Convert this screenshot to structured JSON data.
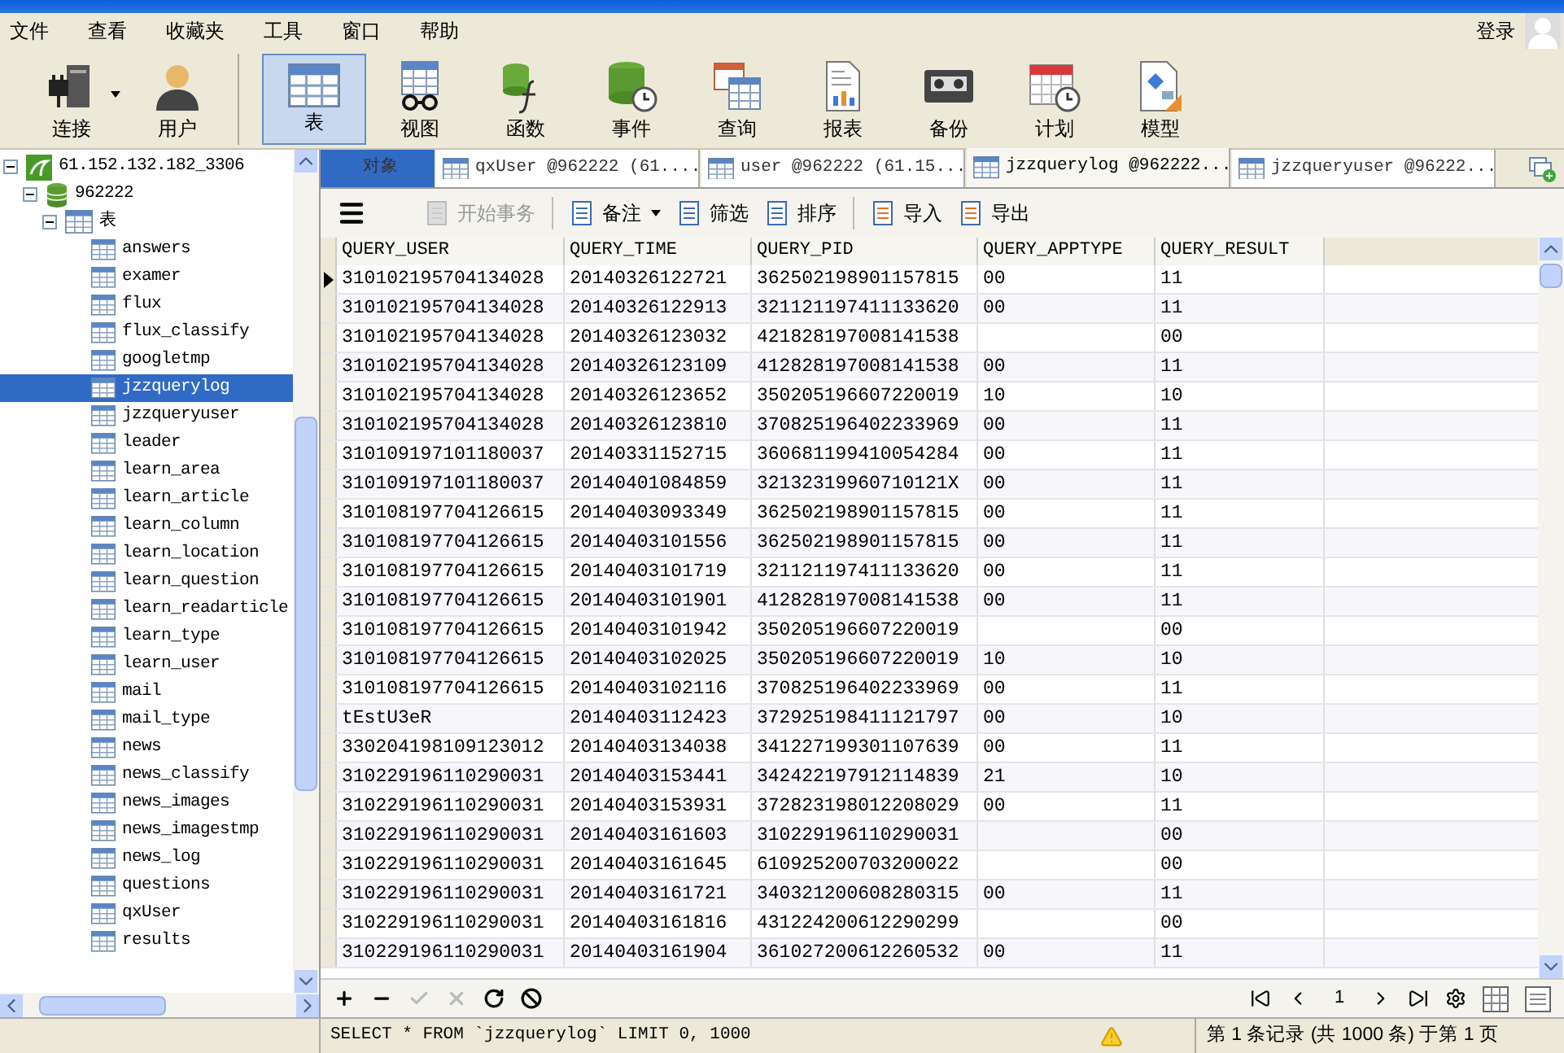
{
  "menu": [
    "文件",
    "查看",
    "收藏夹",
    "工具",
    "窗口",
    "帮助"
  ],
  "login": "登录",
  "toolbar": [
    {
      "label": "连接",
      "selected": false,
      "dropdown": true
    },
    {
      "label": "用户",
      "selected": false,
      "dropdown": false
    },
    {
      "label": "表",
      "selected": true,
      "dropdown": false
    },
    {
      "label": "视图",
      "selected": false,
      "dropdown": false
    },
    {
      "label": "函数",
      "selected": false,
      "dropdown": false
    },
    {
      "label": "事件",
      "selected": false,
      "dropdown": false
    },
    {
      "label": "查询",
      "selected": false,
      "dropdown": false
    },
    {
      "label": "报表",
      "selected": false,
      "dropdown": false
    },
    {
      "label": "备份",
      "selected": false,
      "dropdown": false
    },
    {
      "label": "计划",
      "selected": false,
      "dropdown": false
    },
    {
      "label": "模型",
      "selected": false,
      "dropdown": false
    }
  ],
  "tree": [
    {
      "label": "61.152.132.182_3306",
      "kind": "server",
      "expanded": true,
      "selected": false,
      "children": [
        {
          "label": "962222",
          "kind": "database",
          "expanded": true,
          "selected": false,
          "children": [
            {
              "label": "表",
              "kind": "folder",
              "expanded": true,
              "selected": false,
              "children": [
                {
                  "label": "answers",
                  "kind": "table",
                  "selected": false
                },
                {
                  "label": "examer",
                  "kind": "table",
                  "selected": false
                },
                {
                  "label": "flux",
                  "kind": "table",
                  "selected": false
                },
                {
                  "label": "flux_classify",
                  "kind": "table",
                  "selected": false
                },
                {
                  "label": "googletmp",
                  "kind": "table",
                  "selected": false
                },
                {
                  "label": "jzzquerylog",
                  "kind": "table",
                  "selected": true
                },
                {
                  "label": "jzzqueryuser",
                  "kind": "table",
                  "selected": false
                },
                {
                  "label": "leader",
                  "kind": "table",
                  "selected": false
                },
                {
                  "label": "learn_area",
                  "kind": "table",
                  "selected": false
                },
                {
                  "label": "learn_article",
                  "kind": "table",
                  "selected": false
                },
                {
                  "label": "learn_column",
                  "kind": "table",
                  "selected": false
                },
                {
                  "label": "learn_location",
                  "kind": "table",
                  "selected": false
                },
                {
                  "label": "learn_question",
                  "kind": "table",
                  "selected": false
                },
                {
                  "label": "learn_readarticle",
                  "kind": "table",
                  "selected": false
                },
                {
                  "label": "learn_type",
                  "kind": "table",
                  "selected": false
                },
                {
                  "label": "learn_user",
                  "kind": "table",
                  "selected": false
                },
                {
                  "label": "mail",
                  "kind": "table",
                  "selected": false
                },
                {
                  "label": "mail_type",
                  "kind": "table",
                  "selected": false
                },
                {
                  "label": "news",
                  "kind": "table",
                  "selected": false
                },
                {
                  "label": "news_classify",
                  "kind": "table",
                  "selected": false
                },
                {
                  "label": "news_images",
                  "kind": "table",
                  "selected": false
                },
                {
                  "label": "news_imagestmp",
                  "kind": "table",
                  "selected": false
                },
                {
                  "label": "news_log",
                  "kind": "table",
                  "selected": false
                },
                {
                  "label": "questions",
                  "kind": "table",
                  "selected": false
                },
                {
                  "label": "qxUser",
                  "kind": "table",
                  "selected": false
                },
                {
                  "label": "results",
                  "kind": "table",
                  "selected": false
                }
              ]
            }
          ]
        }
      ]
    }
  ],
  "tabs": [
    {
      "label": "对象",
      "kind": "objects",
      "selected": false
    },
    {
      "label": "qxUser @962222 (61....",
      "kind": "table",
      "selected": false
    },
    {
      "label": "user @962222 (61.15...",
      "kind": "table",
      "selected": false
    },
    {
      "label": "jzzquerylog @962222...",
      "kind": "table",
      "selected": true
    },
    {
      "label": "jzzqueryuser @96222...",
      "kind": "table",
      "selected": false
    }
  ],
  "actions": [
    {
      "label": "开始事务",
      "disabled": true,
      "dropdown": false
    },
    {
      "label": "备注",
      "disabled": false,
      "dropdown": true
    },
    {
      "label": "筛选",
      "disabled": false,
      "dropdown": false
    },
    {
      "label": "排序",
      "disabled": false,
      "dropdown": false
    },
    {
      "label": "导入",
      "disabled": false,
      "dropdown": false
    },
    {
      "label": "导出",
      "disabled": false,
      "dropdown": false
    }
  ],
  "table": {
    "columns": [
      "QUERY_USER",
      "QUERY_TIME",
      "QUERY_PID",
      "QUERY_APPTYPE",
      "QUERY_RESULT"
    ],
    "rows": [
      {
        "current": true,
        "cells": [
          "310102195704134028",
          "20140326122721",
          "362502198901157815",
          "00",
          "11"
        ]
      },
      {
        "current": false,
        "cells": [
          "310102195704134028",
          "20140326122913",
          "321121197411133620",
          "00",
          "11"
        ]
      },
      {
        "current": false,
        "cells": [
          "310102195704134028",
          "20140326123032",
          "421828197008141538",
          "",
          "00"
        ]
      },
      {
        "current": false,
        "cells": [
          "310102195704134028",
          "20140326123109",
          "412828197008141538",
          "00",
          "11"
        ]
      },
      {
        "current": false,
        "cells": [
          "310102195704134028",
          "20140326123652",
          "350205196607220019",
          "10",
          "10"
        ]
      },
      {
        "current": false,
        "cells": [
          "310102195704134028",
          "20140326123810",
          "370825196402233969",
          "00",
          "11"
        ]
      },
      {
        "current": false,
        "cells": [
          "310109197101180037",
          "20140331152715",
          "360681199410054284",
          "00",
          "11"
        ]
      },
      {
        "current": false,
        "cells": [
          "310109197101180037",
          "20140401084859",
          "32132319960710121X",
          "00",
          "11"
        ]
      },
      {
        "current": false,
        "cells": [
          "310108197704126615",
          "20140403093349",
          "362502198901157815",
          "00",
          "11"
        ]
      },
      {
        "current": false,
        "cells": [
          "310108197704126615",
          "20140403101556",
          "362502198901157815",
          "00",
          "11"
        ]
      },
      {
        "current": false,
        "cells": [
          "310108197704126615",
          "20140403101719",
          "321121197411133620",
          "00",
          "11"
        ]
      },
      {
        "current": false,
        "cells": [
          "310108197704126615",
          "20140403101901",
          "412828197008141538",
          "00",
          "11"
        ]
      },
      {
        "current": false,
        "cells": [
          "310108197704126615",
          "20140403101942",
          "350205196607220019",
          "",
          "00"
        ]
      },
      {
        "current": false,
        "cells": [
          "310108197704126615",
          "20140403102025",
          "350205196607220019",
          "10",
          "10"
        ]
      },
      {
        "current": false,
        "cells": [
          "310108197704126615",
          "20140403102116",
          "370825196402233969",
          "00",
          "11"
        ]
      },
      {
        "current": false,
        "cells": [
          "tEstU3eR",
          "20140403112423",
          "372925198411121797",
          "00",
          "10"
        ]
      },
      {
        "current": false,
        "cells": [
          "330204198109123012",
          "20140403134038",
          "341227199301107639",
          "00",
          "11"
        ]
      },
      {
        "current": false,
        "cells": [
          "310229196110290031",
          "20140403153441",
          "342422197912114839",
          "21",
          "10"
        ]
      },
      {
        "current": false,
        "cells": [
          "310229196110290031",
          "20140403153931",
          "372823198012208029",
          "00",
          "11"
        ]
      },
      {
        "current": false,
        "cells": [
          "310229196110290031",
          "20140403161603",
          "310229196110290031",
          "",
          "00"
        ]
      },
      {
        "current": false,
        "cells": [
          "310229196110290031",
          "20140403161645",
          "610925200703200022",
          "",
          "00"
        ]
      },
      {
        "current": false,
        "cells": [
          "310229196110290031",
          "20140403161721",
          "340321200608280315",
          "00",
          "11"
        ]
      },
      {
        "current": false,
        "cells": [
          "310229196110290031",
          "20140403161816",
          "431224200612290299",
          "",
          "00"
        ]
      },
      {
        "current": false,
        "cells": [
          "310229196110290031",
          "20140403161904",
          "361027200612260532",
          "00",
          "11"
        ]
      }
    ]
  },
  "record_tools": [
    {
      "kind": "add",
      "disabled": false
    },
    {
      "kind": "delete",
      "disabled": false
    },
    {
      "kind": "apply",
      "disabled": true
    },
    {
      "kind": "discard",
      "disabled": true
    },
    {
      "kind": "refresh",
      "disabled": false
    },
    {
      "kind": "stop",
      "disabled": false
    }
  ],
  "page": "1",
  "status": {
    "sql": "SELECT * FROM `jzzquerylog` LIMIT 0, 1000",
    "record": "第 1 条记录 (共 1000 条) 于第 1 页"
  }
}
